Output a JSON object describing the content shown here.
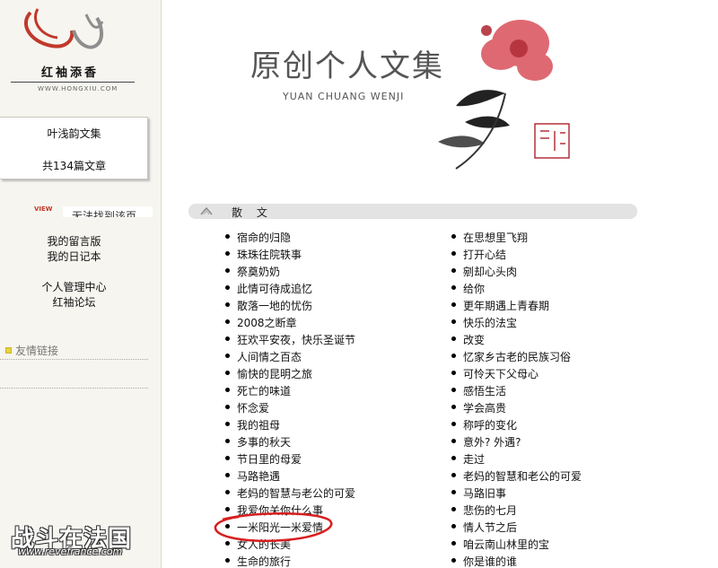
{
  "logo": {
    "name": "红袖添香",
    "url": "WWW.HONGXIU.COM"
  },
  "author_card": {
    "collection": "叶浅韵文集",
    "count": "共134篇文章"
  },
  "view_tag": "VIEW",
  "marquee": "无法找到该页",
  "side_links": {
    "guestbook": "我的留言版",
    "diary": "我的日记本",
    "personal_center": "个人管理中心",
    "forum": "红袖论坛"
  },
  "friends": {
    "label": "友情链接"
  },
  "header": {
    "title": "原创个人文集",
    "subtitle": "YUAN CHUANG WENJI"
  },
  "section": {
    "title": "散 文"
  },
  "articles_left": [
    "宿命的归隐",
    "珠珠往院轶事",
    "祭奠奶奶",
    "此情可待成追忆",
    "散落一地的忧伤",
    "2008之断章",
    "狂欢平安夜，快乐圣诞节",
    "人间情之百态",
    "愉快的昆明之旅",
    "死亡的味道",
    "怀念爱",
    "我的祖母",
    "多事的秋天",
    "节日里的母爱",
    "马路艳遇",
    "老妈的智慧与老公的可爱",
    "我爱你关你什么事",
    "一米阳光一米爱情",
    "女人的长美",
    "生命的旅行"
  ],
  "articles_right": [
    "在思想里飞翔",
    "打开心结",
    "剜却心头肉",
    "给你",
    "更年期遇上青春期",
    "快乐的法宝",
    "改变",
    "忆家乡古老的民族习俗",
    "可怜天下父母心",
    "感悟生活",
    "学会高贵",
    "称呼的变化",
    "意外? 外遇?",
    "走过",
    "老妈的智慧和老公的可爱",
    "马路旧事",
    "悲伤的七月",
    "情人节之后",
    "咱云南山林里的宝",
    "你是谁的谁"
  ],
  "watermark": {
    "cn": "战斗在法国",
    "en": "www.revefrance.com"
  },
  "colors": {
    "sidebar_bg": "#f6f5ef",
    "annotation": "#d81e1e",
    "flower": "#d9505a"
  }
}
